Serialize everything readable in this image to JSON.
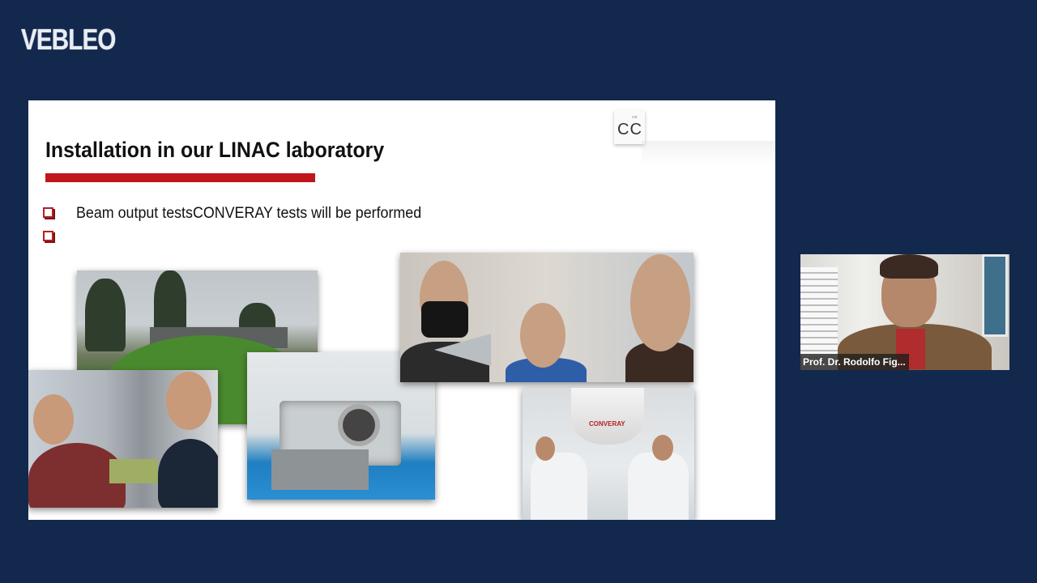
{
  "brand": {
    "logo_text": "VEBLEO"
  },
  "slide": {
    "title": "Installation in our LINAC  laboratory",
    "corner_logo": {
      "tiny_text": "cor",
      "text": "CC"
    },
    "bullets": [
      {
        "text": "Beam output testsCONVERAY tests will be performed"
      },
      {
        "text": ""
      }
    ],
    "photos": {
      "conveyor_label": "CONVERAY"
    }
  },
  "video_tile": {
    "participant_name": "Prof. Dr. Rodolfo Fig..."
  },
  "colors": {
    "background": "#13284d",
    "accent_red": "#c0161c",
    "slide_bg": "#ffffff"
  }
}
